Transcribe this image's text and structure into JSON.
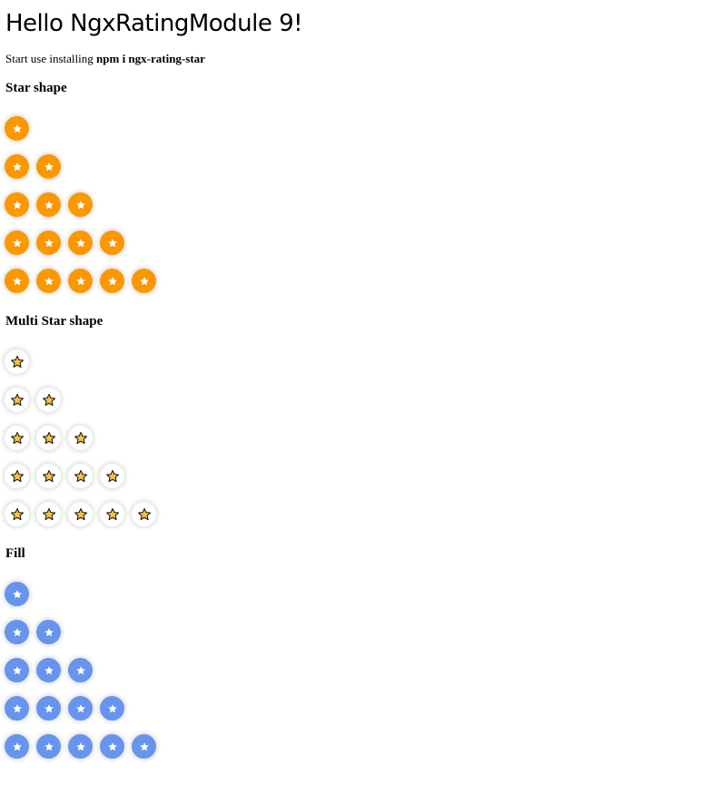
{
  "header": {
    "title": "Hello NgxRatingModule 9!",
    "intro_prefix": "Start use installing ",
    "intro_command": "npm i ngx-rating-star"
  },
  "colors": {
    "solid": "#fb9800",
    "fill": "#6694ee",
    "star_white": "#ffffff",
    "star_gold": "#fcc23a",
    "star_outline": "#1a1a1a"
  },
  "icons": {
    "solid_star": "star-icon",
    "multi_star": "outlined-star-icon",
    "fill_star": "star-icon"
  },
  "sections": [
    {
      "key": "star",
      "title": "Star shape",
      "style": "solid",
      "ratings": [
        1,
        2,
        3,
        4,
        5
      ]
    },
    {
      "key": "multi",
      "title": "Multi Star shape",
      "style": "multi",
      "ratings": [
        1,
        2,
        3,
        4,
        5
      ]
    },
    {
      "key": "fill",
      "title": "Fill",
      "style": "fill",
      "ratings": [
        1,
        2,
        3,
        4,
        5
      ]
    }
  ]
}
